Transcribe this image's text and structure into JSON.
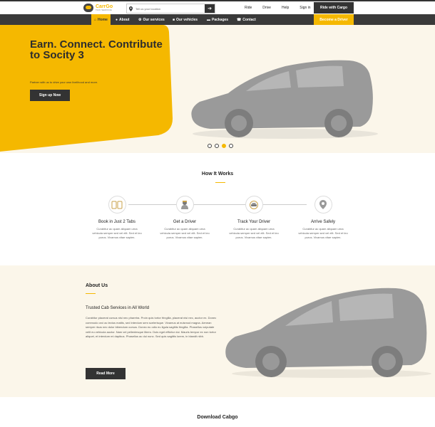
{
  "colors": {
    "accent": "#f5b800",
    "dark": "#333333",
    "cream": "#fbf6ea"
  },
  "header": {
    "logo": {
      "name": "CarrGo",
      "tagline": "TAXI SERVICE",
      "icon": "logo-icon"
    },
    "location": {
      "placeholder": "Tell us your location",
      "icon": "pin-icon",
      "go_icon": "arrow-right-icon"
    },
    "top_links": [
      "Ride",
      "Drive",
      "Help",
      "Sign in"
    ],
    "ride_button": "Ride with Cargo"
  },
  "nav": {
    "items": [
      {
        "label": "Home",
        "icon": "home-icon"
      },
      {
        "label": "About",
        "icon": "user-icon"
      },
      {
        "label": "Our services",
        "icon": "gear-icon"
      },
      {
        "label": "Our vehicles",
        "icon": "car-icon"
      },
      {
        "label": "Packages",
        "icon": "briefcase-icon"
      },
      {
        "label": "Contact",
        "icon": "phone-icon"
      }
    ],
    "active_index": 0,
    "driver_button": "Become a Driver"
  },
  "hero": {
    "title": "Earn. Connect. Contribute to Socity 3",
    "subtitle": "Partner with us to drive your own livelihood and more.",
    "button": "Sign up Now",
    "slides": 4,
    "active_slide": 2
  },
  "how_it_works": {
    "title": "How It Works",
    "steps": [
      {
        "title": "Book in Just 2 Tabs",
        "desc": "Curabitur ac quam aliquam urna vehicula semper sed vel elit. Sed et leo purus. Vivamus vitae sapien.",
        "icon": "phone-tap-icon"
      },
      {
        "title": "Get a Driver",
        "desc": "Curabitur ac quam aliquam urna vehicula semper sed vel elit. Sed et leo purus. Vivamus vitae sapien.",
        "icon": "driver-icon"
      },
      {
        "title": "Track Your Driver",
        "desc": "Curabitur ac quam aliquam urna vehicula semper sed vel elit. Sed et leo purus. Vivamus vitae sapien.",
        "icon": "track-car-icon"
      },
      {
        "title": "Arrive Safely",
        "desc": "Curabitur ac quam aliquam urna vehicula semper sed vel elit. Sed et leo purus. Vivamus vitae sapien.",
        "icon": "location-pin-icon"
      }
    ]
  },
  "about": {
    "title": "About Us",
    "subtitle": "Trusted Cab Services in All World",
    "text": "Curabitur placerat cursus nisi nec pharetra. Proin quis tortor fringilla, placerat nisi nec, auctor ex. Donec commodo orci ac lectus mattis, sed interdum sem scelerisque. Vivamus at euismod magna. Aenean semper risus nec dolor bibendum cursus. Donec eu odio eu ligula sagittis fringilla. Phasellus vulputate velit eu vehicula auctor. Nam vel pellentesque libero. Duis eget efficitur dui. Mauris tempor ex non tortor aliquet, et interdum mi dapibus. Phasellus ac dui nunc. Sed quis sagittis lorem, in blandit nibh.",
    "button": "Read More"
  },
  "download": {
    "title": "Download Cabgo"
  }
}
